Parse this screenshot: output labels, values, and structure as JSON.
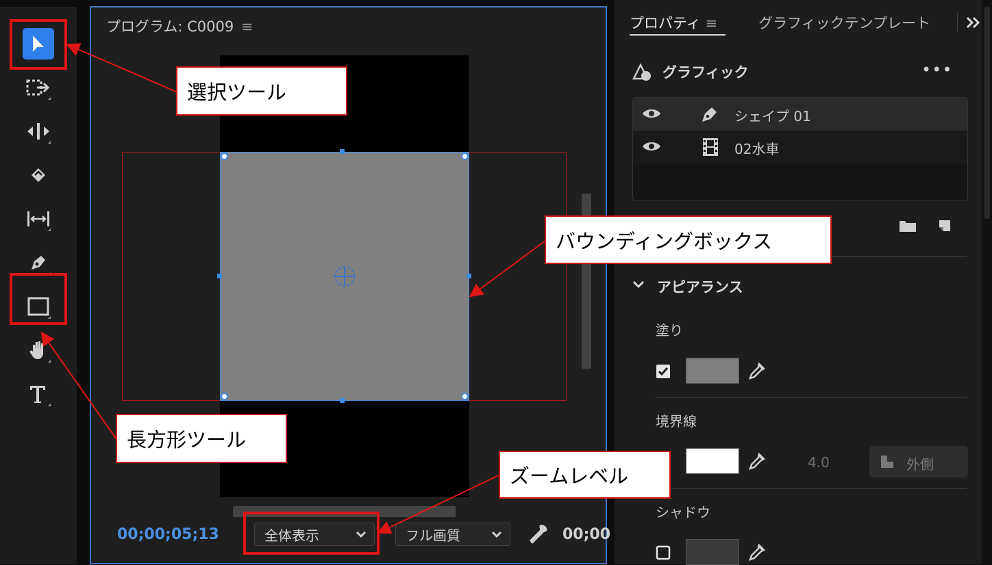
{
  "program": {
    "title": "プログラム: C0009",
    "timecode": "00;00;05;13",
    "zoom_label": "全体表示",
    "quality_label": "フル画質",
    "timecode_right": "00;00"
  },
  "panel": {
    "tab_properties": "プロパティ",
    "tab_templates": "グラフィックテンプレート",
    "section_graphic": "グラフィック",
    "layers": [
      {
        "name": "シェイプ 01",
        "icon": "pen-icon"
      },
      {
        "name": "02水車",
        "icon": "film-icon"
      }
    ],
    "appearance": "アピアランス",
    "fill_label": "塗り",
    "stroke_label": "境界線",
    "stroke_width": "4.0",
    "stroke_position": "外側",
    "shadow_label": "シャドウ",
    "colors": {
      "fill": "#808080",
      "stroke": "#ffffff",
      "accent": "#3c8de6"
    }
  },
  "callouts": {
    "select_tool": "選択ツール",
    "bounding_box": "バウンディングボックス",
    "rect_tool": "長方形ツール",
    "zoom_level": "ズームレベル"
  }
}
